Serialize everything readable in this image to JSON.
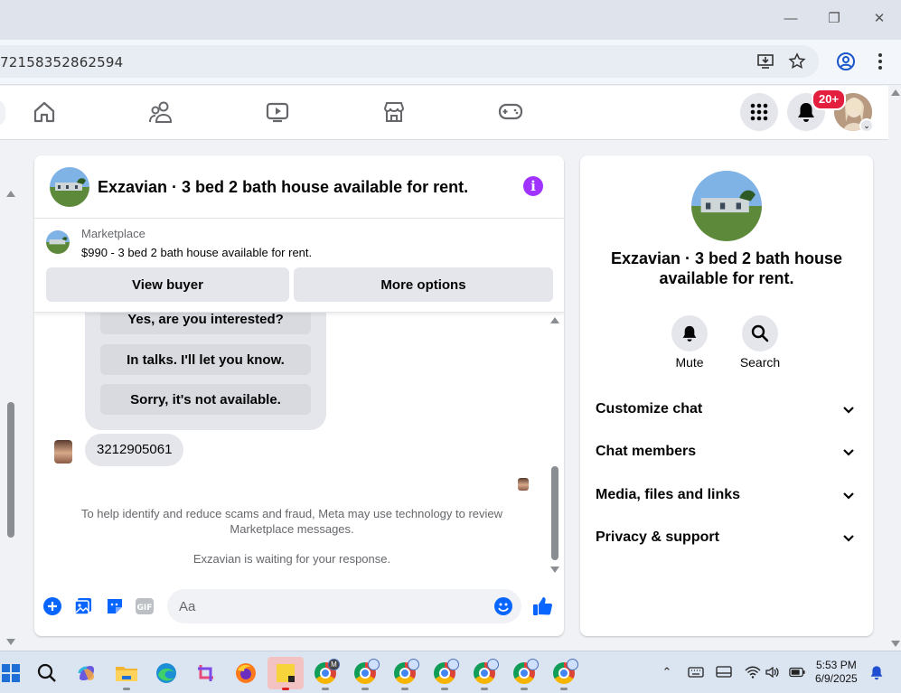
{
  "browser": {
    "url": "72158352862594",
    "window_controls": [
      "minimize",
      "restore",
      "close"
    ]
  },
  "fb_nav": {
    "notification_count": "20+"
  },
  "chat": {
    "title": "Exzavian · 3 bed 2 bath house available for rent.",
    "marketplace_label": "Marketplace",
    "listing": "$990 - 3 bed 2 bath house available for rent.",
    "view_buyer": "View buyer",
    "more_options": "More options",
    "quick_replies": [
      "Yes, are you interested?",
      "In talks. I'll let you know.",
      "Sorry, it's not available."
    ],
    "incoming_message": "3212905061",
    "notice": "To help identify and reduce scams and fraud, Meta may use technology to review Marketplace messages.",
    "waiting": "Exzavian is waiting for your response.",
    "composer_placeholder": "Aa"
  },
  "details": {
    "title": "Exzavian · 3 bed 2 bath house available for rent.",
    "actions": [
      {
        "label": "Mute",
        "icon": "bell-icon"
      },
      {
        "label": "Search",
        "icon": "search-icon"
      }
    ],
    "sections": [
      "Customize chat",
      "Chat members",
      "Media, files and links",
      "Privacy & support"
    ]
  },
  "taskbar": {
    "time": "5:53 PM",
    "date": "6/9/2025"
  },
  "colors": {
    "accent": "#0866ff",
    "info": "#a033ff",
    "badge": "#e41e3f"
  }
}
